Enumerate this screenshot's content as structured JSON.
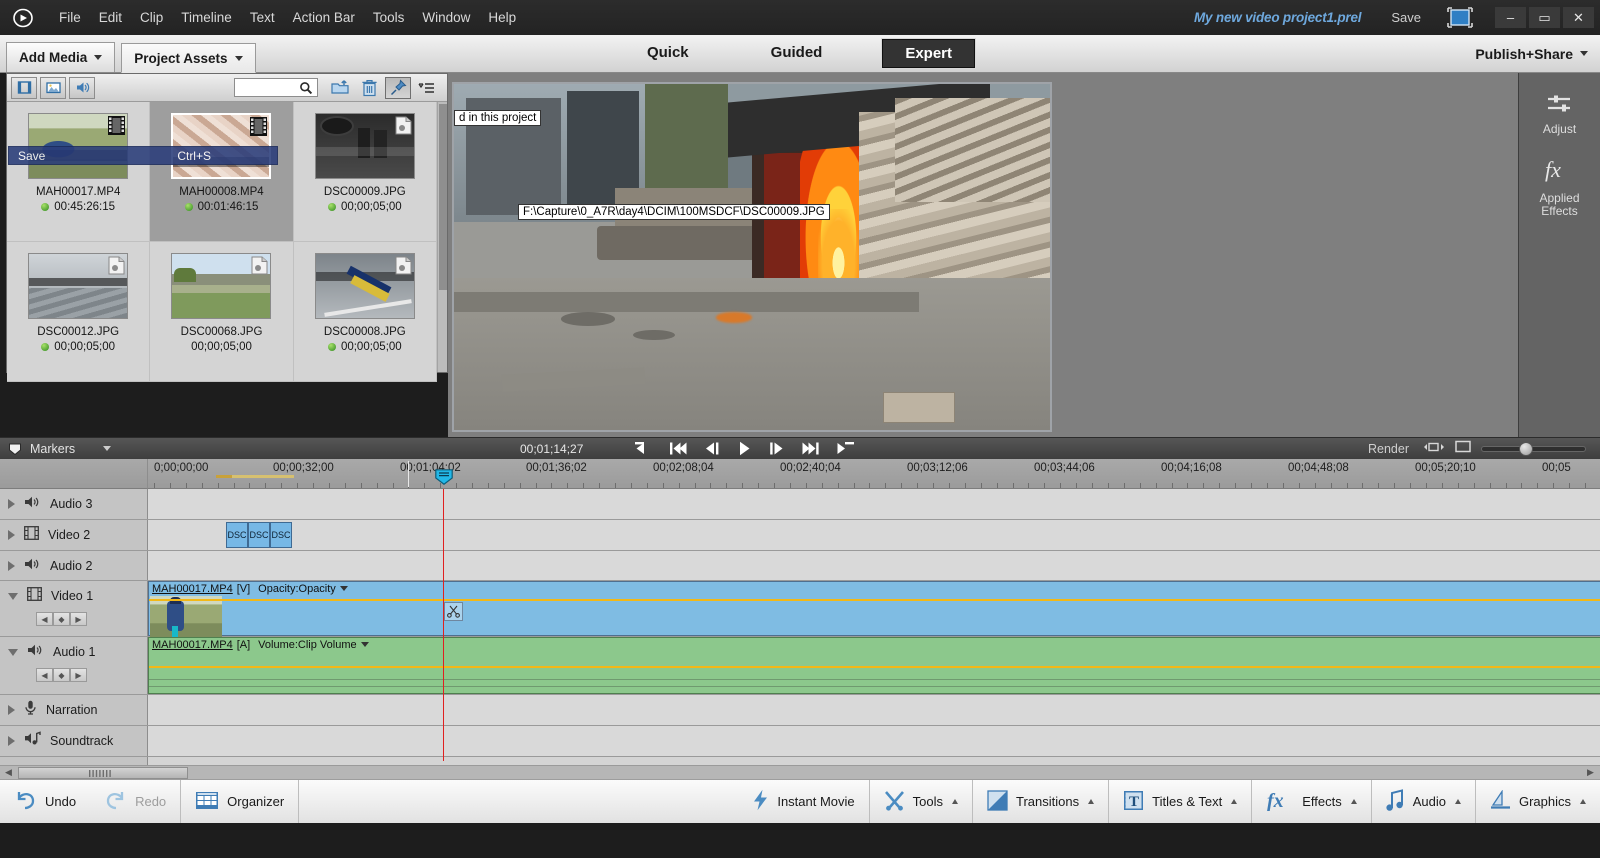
{
  "titlebar": {
    "menu": [
      "File",
      "Edit",
      "Clip",
      "Timeline",
      "Text",
      "Action Bar",
      "Tools",
      "Window",
      "Help"
    ],
    "project_name": "My new video project1.prel",
    "save_label": "Save",
    "screen_mode_icon": "monitor-icon",
    "window_buttons": {
      "minimize": "–",
      "maximize": "▭",
      "close": "✕"
    }
  },
  "tabbar": {
    "add_media": "Add Media",
    "project_assets": "Project Assets",
    "modes": [
      "Quick",
      "Guided",
      "Expert"
    ],
    "selected_mode": "Expert",
    "publish_share": "Publish+Share"
  },
  "assets_panel": {
    "toolbar_icons": [
      "video-filter-icon",
      "photo-filter-icon",
      "audio-filter-icon",
      "new-folder-icon",
      "delete-icon",
      "pin-icon",
      "panel-menu-icon"
    ],
    "search_value": "",
    "search_placeholder": "",
    "items": [
      {
        "name": "MAH00017.MP4",
        "duration": "00:45:26:15",
        "type": "video",
        "selected": false,
        "has_dot": true
      },
      {
        "name": "MAH00008.MP4",
        "duration": "00:01:46:15",
        "type": "video",
        "selected": true,
        "has_dot": true
      },
      {
        "name": "DSC00009.JPG",
        "duration": "00;00;05;00",
        "type": "image",
        "selected": false,
        "has_dot": true
      },
      {
        "name": "DSC00012.JPG",
        "duration": "00;00;05;00",
        "type": "image",
        "selected": false,
        "has_dot": true
      },
      {
        "name": "DSC00068.JPG",
        "duration": "00;00;05;00",
        "type": "image",
        "selected": false,
        "has_dot": false
      },
      {
        "name": "DSC00008.JPG",
        "duration": "00;00;05;00",
        "type": "image",
        "selected": false,
        "has_dot": true
      }
    ]
  },
  "tooltip": {
    "label": "Save",
    "shortcut": "Ctrl+S"
  },
  "monitor": {
    "overlay_project": "d in this project",
    "overlay_path": "F:\\Capture\\0_A7R\\day4\\DCIM\\100MSDCF\\DSC00009.JPG"
  },
  "transport": {
    "timecode": "00;01;14;27",
    "buttons": [
      "go-to-in-point",
      "go-to-previous-edit",
      "step-back",
      "play",
      "step-forward",
      "go-to-next-edit",
      "go-to-out-point"
    ],
    "render_label": "Render",
    "zoom_value": 35
  },
  "right_rail": [
    {
      "label": "Adjust",
      "icon": "sliders-icon"
    },
    {
      "label": "Applied\nEffects",
      "icon": "fx-icon"
    }
  ],
  "markers": {
    "label": "Markers"
  },
  "timeline": {
    "ruler_labels": [
      "0;00;00;00",
      "00;00;32;00",
      "00;01;04;02",
      "00;01;36;02",
      "00;02;08;04",
      "00;02;40;04",
      "00;03;12;06",
      "00;03;44;06",
      "00;04;16;08",
      "00;04;48;08",
      "00;05;20;10",
      "00;05"
    ],
    "playhead_time": "00;01;04;02",
    "tracks": [
      {
        "name": "Audio 3",
        "icon": "speaker-icon",
        "expanded": false
      },
      {
        "name": "Video 2",
        "icon": "film-icon",
        "expanded": false
      },
      {
        "name": "Audio 2",
        "icon": "speaker-icon",
        "expanded": false
      },
      {
        "name": "Video 1",
        "icon": "film-icon",
        "expanded": true
      },
      {
        "name": "Audio 1",
        "icon": "speaker-icon",
        "expanded": true
      },
      {
        "name": "Narration",
        "icon": "mic-icon",
        "expanded": false
      },
      {
        "name": "Soundtrack",
        "icon": "music-icon",
        "expanded": false
      }
    ],
    "video2_clips": [
      "DSC",
      "DSC",
      "DSC"
    ],
    "video1_clip": {
      "name": "MAH00017.MP4",
      "channel": "[V]",
      "effect": "Opacity:Opacity"
    },
    "audio1_clip": {
      "name": "MAH00017.MP4",
      "channel": "[A]",
      "effect": "Volume:Clip Volume"
    }
  },
  "action_bar": {
    "undo": "Undo",
    "redo": "Redo",
    "organizer": "Organizer",
    "right_items": [
      {
        "label": "Instant Movie",
        "icon": "bolt-icon",
        "caret": false
      },
      {
        "label": "Tools",
        "icon": "tools-icon",
        "caret": true
      },
      {
        "label": "Transitions",
        "icon": "transitions-icon",
        "caret": true
      },
      {
        "label": "Titles & Text",
        "icon": "titles-icon",
        "caret": true
      },
      {
        "label": "Effects",
        "icon": "fx-icon",
        "caret": true
      },
      {
        "label": "Audio",
        "icon": "music-note-icon",
        "caret": true
      },
      {
        "label": "Graphics",
        "icon": "graphics-icon",
        "caret": true
      }
    ]
  },
  "colors": {
    "accent_purple": "#a8248a",
    "video_clip": "#7fbce3",
    "audio_clip": "#8cc88c",
    "playhead": "#e02020",
    "rubberband": "#f3b816",
    "tooltip_blue": "#2a3d7a"
  }
}
